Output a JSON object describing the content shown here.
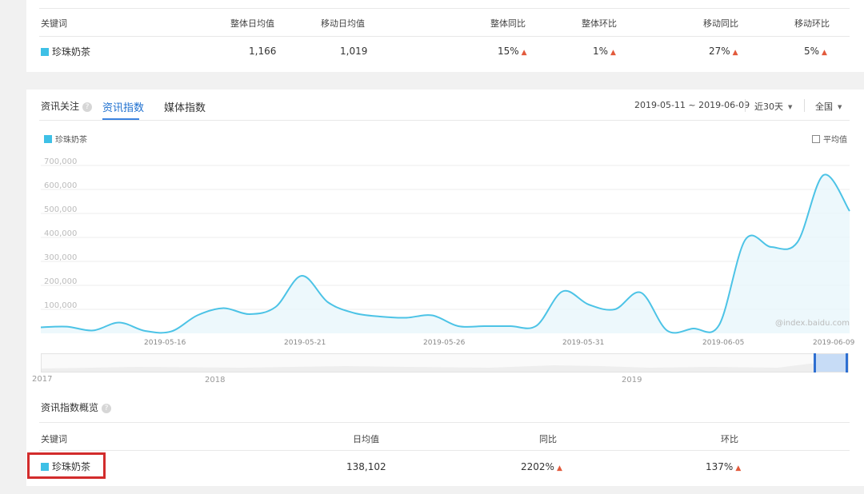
{
  "top_table": {
    "headers": [
      "关键词",
      "整体日均值",
      "移动日均值",
      "整体同比",
      "整体环比",
      "移动同比",
      "移动环比"
    ],
    "row": {
      "keyword": "珍珠奶茶",
      "overall_daily_avg": "1,166",
      "mobile_daily_avg": "1,019",
      "overall_yoy": "15%",
      "overall_mom": "1%",
      "mobile_yoy": "27%",
      "mobile_mom": "5%"
    }
  },
  "section": {
    "title": "资讯关注",
    "tabs": [
      "资讯指数",
      "媒体指数"
    ],
    "active_tab": "资讯指数",
    "date_range": "2019-05-11 ~ 2019-06-09",
    "period_select": "近30天",
    "region_select": "全国",
    "legend_label": "珍珠奶茶",
    "average_toggle_label": "平均值",
    "watermark": "@index.baidu.com"
  },
  "chart_data": {
    "type": "area",
    "series": [
      {
        "name": "珍珠奶茶",
        "color": "#4cc3e6",
        "values": [
          25000,
          28000,
          12000,
          45000,
          10000,
          8000,
          75000,
          105000,
          80000,
          110000,
          240000,
          130000,
          85000,
          70000,
          65000,
          75000,
          30000,
          30000,
          30000,
          32000,
          175000,
          120000,
          100000,
          170000,
          12000,
          20000,
          35000,
          390000,
          360000,
          380000,
          660000,
          510000
        ]
      }
    ],
    "x_tick_labels": [
      "2019-05-16",
      "2019-05-21",
      "2019-05-26",
      "2019-05-31",
      "2019-06-05",
      "2019-06-09"
    ],
    "y_tick_labels": [
      "100,000",
      "200,000",
      "300,000",
      "400,000",
      "500,000",
      "600,000",
      "700,000"
    ],
    "ylim": [
      0,
      700000
    ],
    "grid": true,
    "brush_labels": [
      "2017",
      "2018",
      "2019"
    ]
  },
  "overview": {
    "title": "资讯指数概览",
    "headers": [
      "关键词",
      "日均值",
      "同比",
      "环比"
    ],
    "row": {
      "keyword": "珍珠奶茶",
      "daily_avg": "138,102",
      "yoy": "2202%",
      "mom": "137%"
    }
  },
  "colors": {
    "accent": "#3b83e0",
    "series": "#4cc3e6",
    "up_arrow": "#e25a3c",
    "highlight": "#d22c2c"
  }
}
